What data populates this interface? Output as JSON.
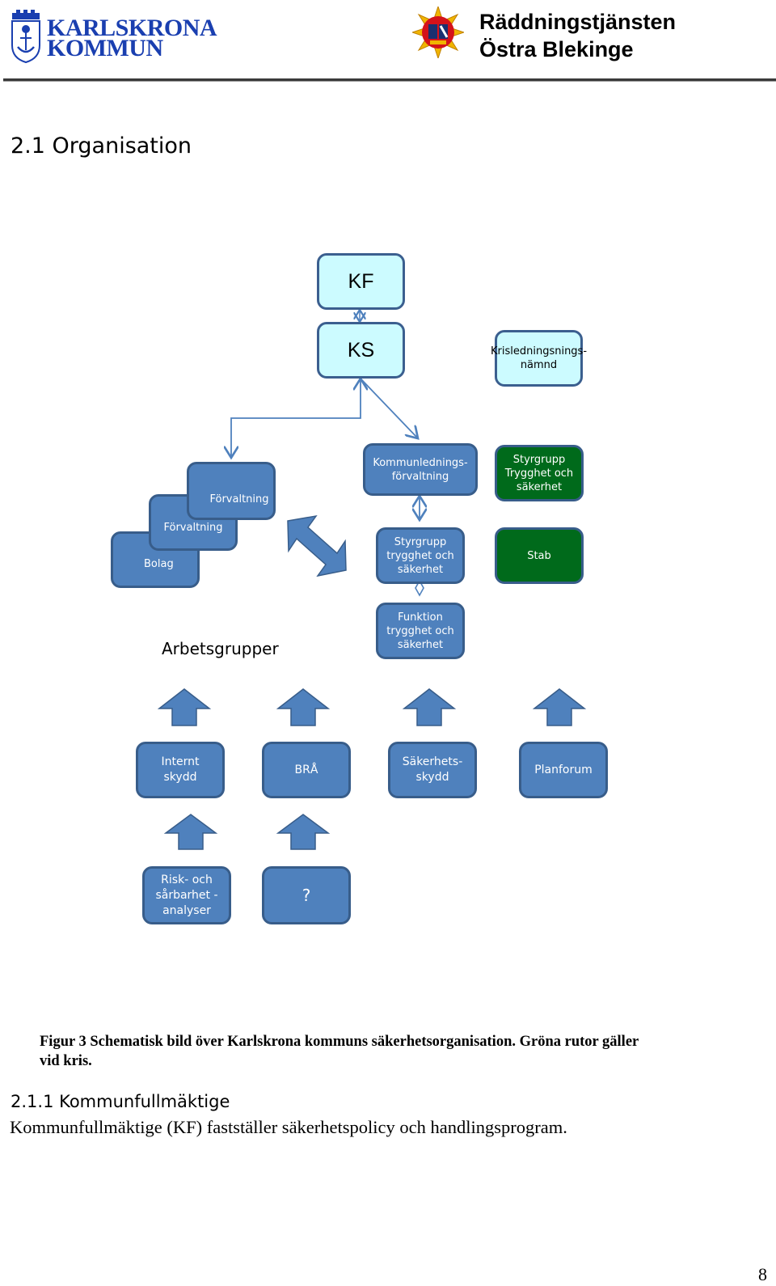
{
  "header": {
    "left_logo": {
      "line1": "KARLSKRONA",
      "line2": "KOMMUN",
      "icon": "karlskrona-coat-of-arms-icon",
      "color": "#1a3fb0"
    },
    "right_logo": {
      "line1": "Räddningstjänsten",
      "line2": "Östra Blekinge",
      "icon": "fire-rescue-star-emblem-icon"
    }
  },
  "section_heading": "2.1 Organisation",
  "diagram": {
    "colors": {
      "light": "#ccfbff",
      "blue": "#4f81bd",
      "green": "#006a1b",
      "border": "#385d8a"
    },
    "nodes": {
      "kf": "KF",
      "ks": "KS",
      "krisledningsnamnd": [
        "Krisledningsnings-",
        "nämnd"
      ],
      "forvaltning_front": "Förvaltning",
      "forvaltning_middle": "Förvaltning",
      "bolag": "Bolag",
      "kommunledningsforvaltning": [
        "Kommunlednings-",
        "förvaltning"
      ],
      "styrgrupp_kris": [
        "Styrgrupp",
        "Trygghet och",
        "säkerhet"
      ],
      "styrgrupp": [
        "Styrgrupp",
        "trygghet och",
        "säkerhet"
      ],
      "stab": "Stab",
      "funktion": [
        "Funktion",
        "trygghet och",
        "säkerhet"
      ],
      "arbetsgrupper_label": "Arbetsgrupper",
      "internt_skydd": [
        "Internt",
        "skydd"
      ],
      "bra": "BRÅ",
      "sakerhetsskydd": [
        "Säkerhets-",
        "skydd"
      ],
      "planforum": "Planforum",
      "risk": [
        "Risk- och",
        "sårbarhet -",
        "analyser"
      ],
      "unknown": "?"
    }
  },
  "caption": "Figur 3 Schematisk bild över Karlskrona kommuns säkerhetsorganisation. Gröna rutor gäller vid kris.",
  "subsection_heading": "2.1.1  Kommunfullmäktige",
  "paragraph": "Kommunfullmäktige (KF) fastställer säkerhetspolicy och handlingsprogram.",
  "page_number": "8"
}
